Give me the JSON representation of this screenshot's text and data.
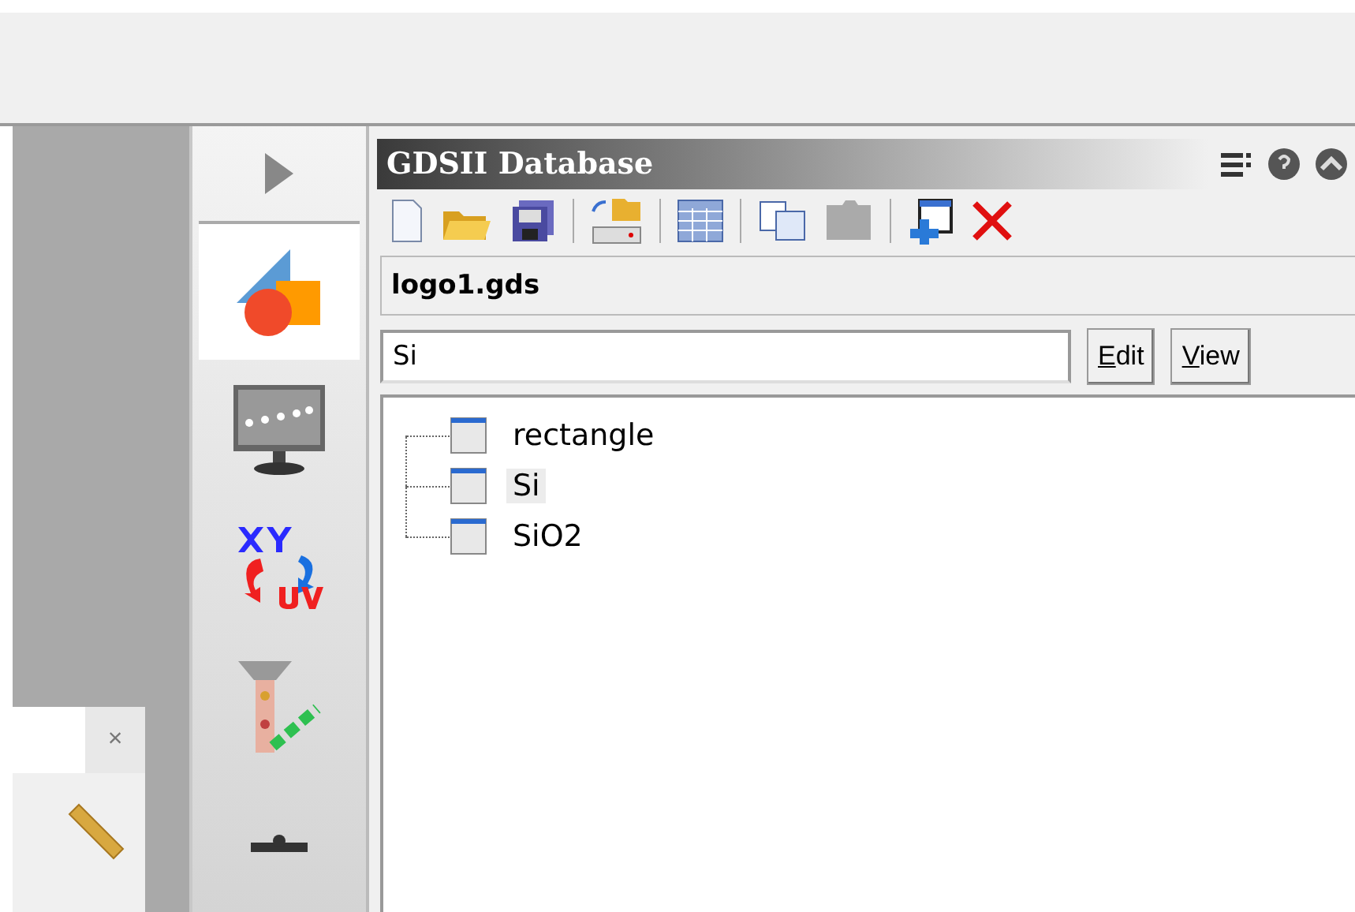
{
  "side_panel": {
    "close_label": "×"
  },
  "vertical_toolbar": {
    "tools": [
      {
        "kind": "shapes",
        "selected": true
      },
      {
        "kind": "monitor",
        "selected": false
      },
      {
        "kind": "transform",
        "selected": false
      },
      {
        "kind": "beam",
        "selected": false
      },
      {
        "kind": "stage",
        "selected": false
      }
    ]
  },
  "panel": {
    "title": "GDSII Database",
    "file_name": "logo1.gds",
    "search": {
      "value": "Si"
    },
    "buttons": [
      "Edit",
      "View"
    ],
    "tree": [
      {
        "label": "rectangle",
        "selected": false
      },
      {
        "label": "Si",
        "selected": true
      },
      {
        "label": "SiO2",
        "selected": false
      }
    ]
  }
}
